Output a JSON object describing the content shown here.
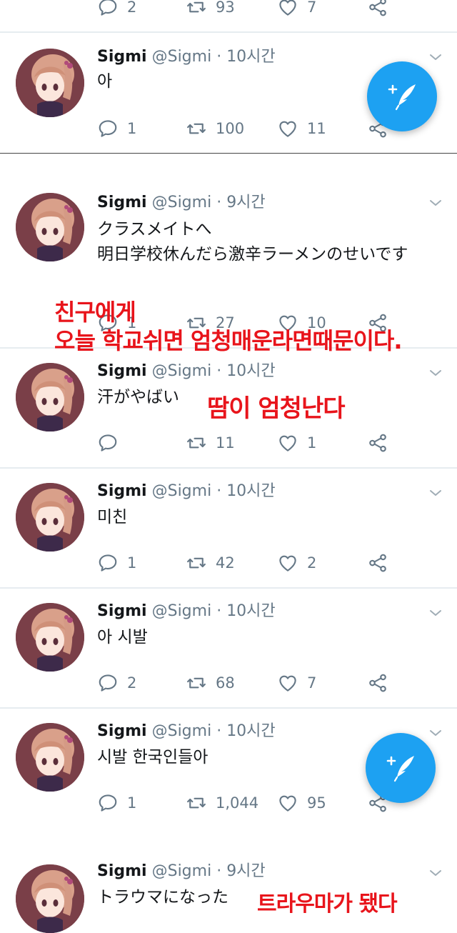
{
  "top_actions": {
    "reply": "2",
    "retweet": "93",
    "like": "7"
  },
  "tweets": [
    {
      "name": "Sigmi",
      "handle": "@Sigmi",
      "time": "10시간",
      "text": "아",
      "reply": "1",
      "retweet": "100",
      "like": "11"
    },
    {
      "name": "Sigmi",
      "handle": "@Sigmi",
      "time": "9시간",
      "text": "クラスメイトへ\n明日学校休んだら激辛ラーメンのせいです",
      "reply": "1",
      "retweet": "27",
      "like": "10"
    },
    {
      "name": "Sigmi",
      "handle": "@Sigmi",
      "time": "10시간",
      "text": "汗がやばい",
      "reply": "",
      "retweet": "11",
      "like": "1"
    },
    {
      "name": "Sigmi",
      "handle": "@Sigmi",
      "time": "10시간",
      "text": "미친",
      "reply": "1",
      "retweet": "42",
      "like": "2"
    },
    {
      "name": "Sigmi",
      "handle": "@Sigmi",
      "time": "10시간",
      "text": "아 시발",
      "reply": "2",
      "retweet": "68",
      "like": "7"
    },
    {
      "name": "Sigmi",
      "handle": "@Sigmi",
      "time": "10시간",
      "text": "시발 한국인들아",
      "reply": "1",
      "retweet": "1,044",
      "like": "95"
    },
    {
      "name": "Sigmi",
      "handle": "@Sigmi",
      "time": "9시간",
      "text": "トラウマになった"
    }
  ],
  "overlays": {
    "line1": "친구에게",
    "line2": "오늘 학교쉬면 엄청매운라면때문이다.",
    "sweat": "땀이 엄청난다",
    "trauma": "트라우마가 됐다"
  },
  "colors": {
    "accent": "#1da1f2",
    "overlay": "#e8141b",
    "meta": "#657786",
    "avatar_bg": "#7a3f48"
  }
}
